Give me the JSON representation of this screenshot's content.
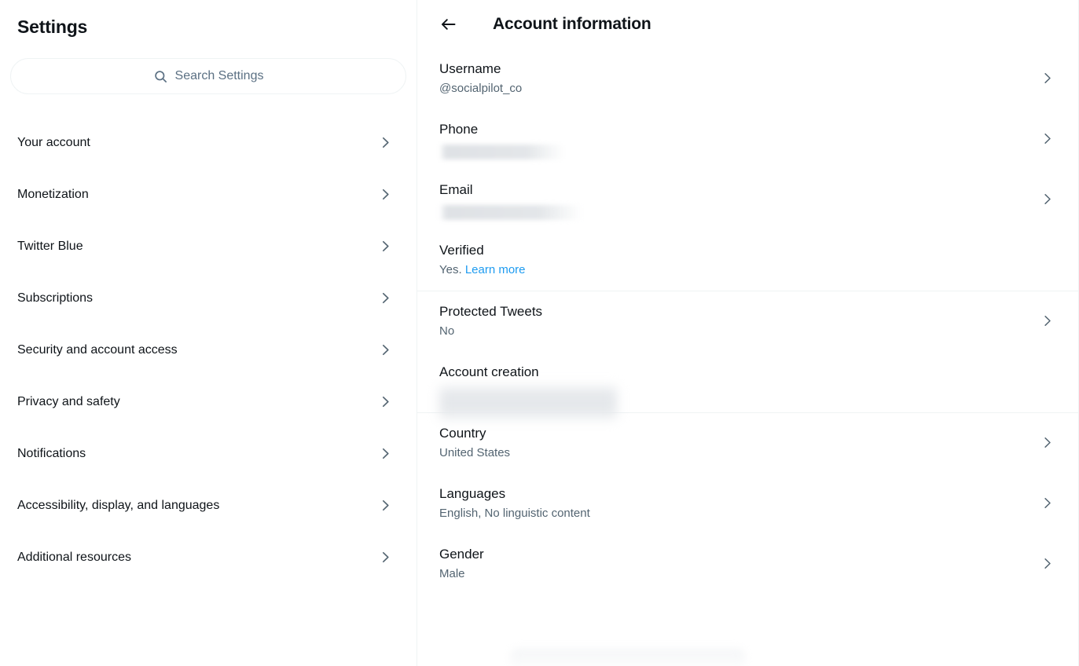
{
  "colors": {
    "text_primary": "#0f1419",
    "text_secondary": "#536471",
    "placeholder": "#5b7083",
    "accent_link": "#1d9bf0",
    "border": "#eff3f4",
    "chevron": "#536471"
  },
  "sidebar": {
    "title": "Settings",
    "search": {
      "placeholder": "Search Settings",
      "value": "",
      "icon": "search-icon"
    },
    "items": [
      {
        "label": "Your account",
        "icon": "chevron-right-icon"
      },
      {
        "label": "Monetization",
        "icon": "chevron-right-icon"
      },
      {
        "label": "Twitter Blue",
        "icon": "chevron-right-icon"
      },
      {
        "label": "Subscriptions",
        "icon": "chevron-right-icon"
      },
      {
        "label": "Security and account access",
        "icon": "chevron-right-icon"
      },
      {
        "label": "Privacy and safety",
        "icon": "chevron-right-icon"
      },
      {
        "label": "Notifications",
        "icon": "chevron-right-icon"
      },
      {
        "label": "Accessibility, display, and languages",
        "icon": "chevron-right-icon"
      },
      {
        "label": "Additional resources",
        "icon": "chevron-right-icon"
      }
    ]
  },
  "panel": {
    "back_icon": "arrow-left-icon",
    "title": "Account information",
    "rows": [
      {
        "label": "Username",
        "value": "@socialpilot_co",
        "redacted": false,
        "chevron": true
      },
      {
        "label": "Phone",
        "value": "",
        "redacted": true,
        "redaction_style": "phone",
        "chevron": true
      },
      {
        "label": "Email",
        "value": "",
        "redacted": true,
        "redaction_style": "email",
        "chevron": true
      },
      {
        "label": "Verified",
        "value": "Yes.",
        "link_label": "Learn more",
        "redacted": false,
        "chevron": false
      },
      {
        "label": "Protected Tweets",
        "value": "No",
        "redacted": false,
        "chevron": true
      },
      {
        "label": "Account creation",
        "value": "",
        "redacted": true,
        "redaction_style": "tall",
        "chevron": false
      },
      {
        "label": "Country",
        "value": "United States",
        "redacted": false,
        "chevron": true
      },
      {
        "label": "Languages",
        "value": "English, No linguistic content",
        "redacted": false,
        "chevron": true
      },
      {
        "label": "Gender",
        "value": "Male",
        "redacted": false,
        "chevron": true
      }
    ]
  }
}
